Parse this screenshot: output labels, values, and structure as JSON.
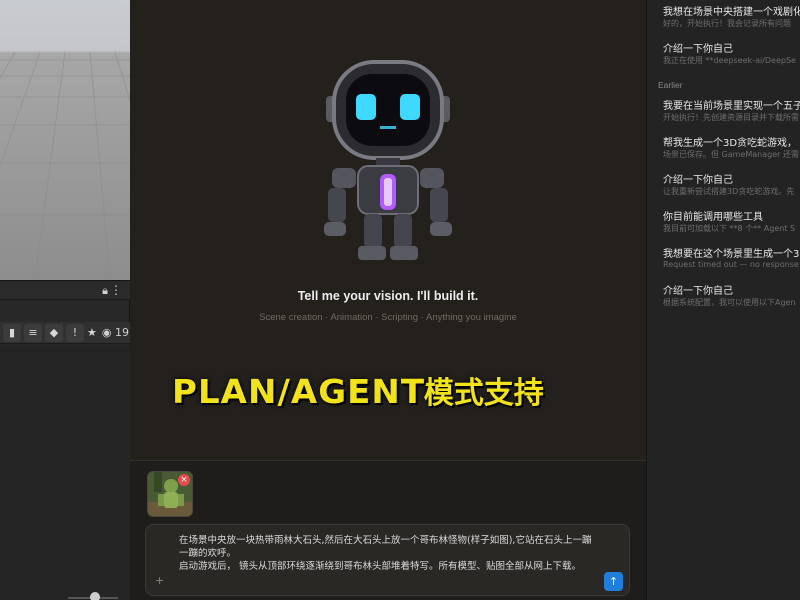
{
  "left_panel": {
    "toolbar_count": "19",
    "lock_icon": "lock-icon",
    "more_icon": "more-vertical-icon"
  },
  "chat": {
    "hero_title": "Tell me your vision. I'll build it.",
    "hero_subtitle": "Scene creation · Animation · Scripting · Anything you imagine",
    "attachment_remove": "×",
    "input_value": "在场景中央放一块热带雨林大石头,然后在大石头上放一个哥布林怪物(样子如图),它站在石头上一蹦一蹦的欢呼。\n启动游戏后， 镜头从顶部环绕逐渐绕到哥布林头部堆着特写。所有模型、贴图全部从网上下载。",
    "add_button": "+",
    "send_button": "↑"
  },
  "history": {
    "recent_items": [
      {
        "title": "我想在场景中央搭建一个戏剧化",
        "subtitle": "好的，开始执行！我会记录所有问题"
      },
      {
        "title": "介绍一下你自己",
        "subtitle": "我正在使用 **deepseek-ai/DeepSe"
      }
    ],
    "earlier_label": "Earlier",
    "earlier_items": [
      {
        "title": "我要在当前场景里实现一个五子",
        "subtitle": "开始执行！先创建资源目录并下载所需"
      },
      {
        "title": "帮我生成一个3D贪吃蛇游戏，",
        "subtitle": "场景已保存。但 GameManager 还需"
      },
      {
        "title": "介绍一下你自己",
        "subtitle": "让我重新尝试搭建3D贪吃蛇游戏。先"
      },
      {
        "title": "你目前能调用哪些工具",
        "subtitle": "我目前可加载以下 **8 个** Agent S"
      },
      {
        "title": "我想要在这个场景里生成一个3",
        "subtitle": "Request timed out — no response"
      },
      {
        "title": "介绍一下你自己",
        "subtitle": "根据系统配置，我可以使用以下Agen"
      }
    ]
  },
  "overlay": {
    "en": "PLAN/AGENT",
    "cn": "模式支持",
    "color": "#f2e21a"
  },
  "colors": {
    "center_bg": "#24211d",
    "right_bg": "#232323",
    "send_button": "#1f7fdb",
    "robot_eyes": "#3fd8ff",
    "robot_core": "#b25cff"
  }
}
